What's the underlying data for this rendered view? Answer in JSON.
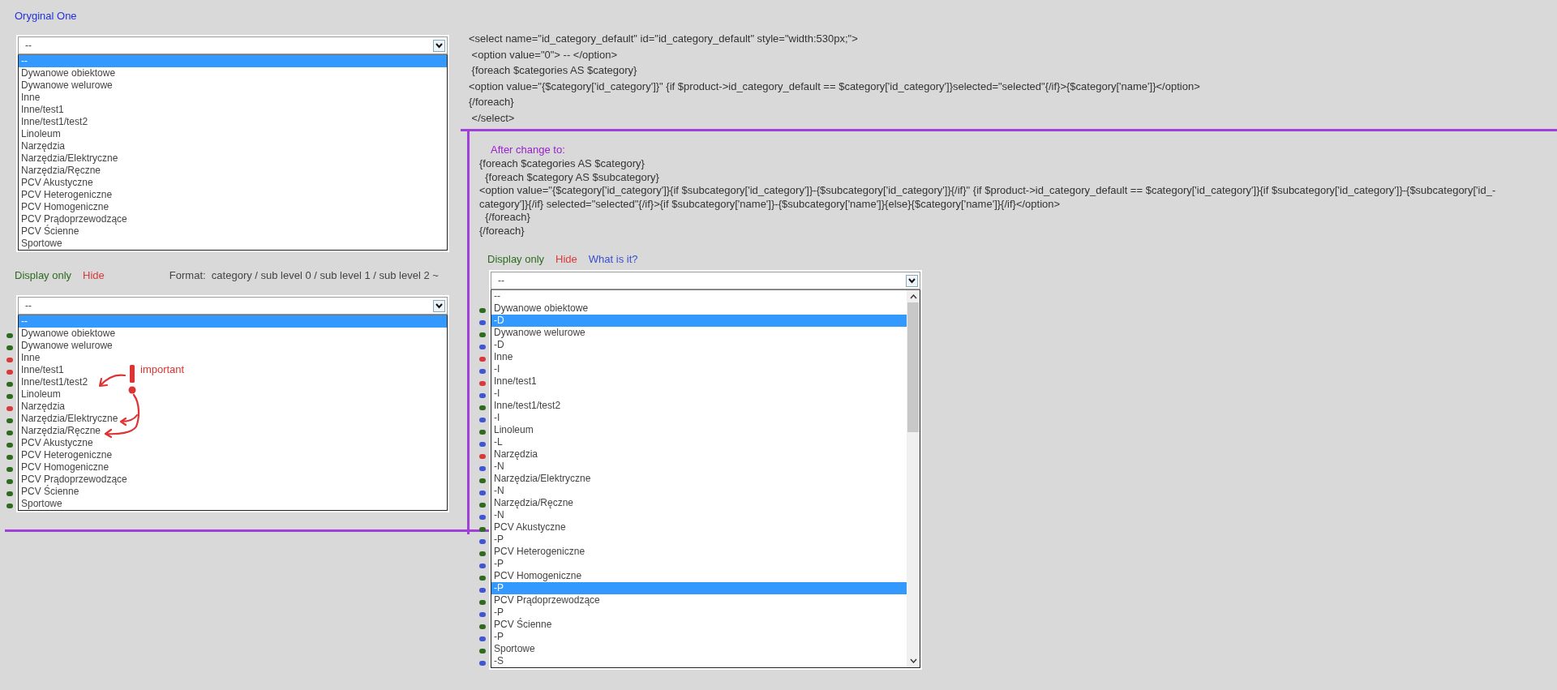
{
  "original": {
    "title": "Oryginal One",
    "dropdown": {
      "value": "--",
      "options": [
        {
          "label": "--",
          "selected": true
        },
        {
          "label": "Dywanowe obiektowe",
          "selected": false
        },
        {
          "label": "Dywanowe welurowe",
          "selected": false
        },
        {
          "label": "Inne",
          "selected": false
        },
        {
          "label": "Inne/test1",
          "selected": false
        },
        {
          "label": "Inne/test1/test2",
          "selected": false
        },
        {
          "label": "Linoleum",
          "selected": false
        },
        {
          "label": "Narzędzia",
          "selected": false
        },
        {
          "label": "Narzędzia/Elektryczne",
          "selected": false
        },
        {
          "label": "Narzędzia/Ręczne",
          "selected": false
        },
        {
          "label": "PCV Akustyczne",
          "selected": false
        },
        {
          "label": "PCV Heterogeniczne",
          "selected": false
        },
        {
          "label": "PCV Homogeniczne",
          "selected": false
        },
        {
          "label": "PCV Prądoprzewodzące",
          "selected": false
        },
        {
          "label": "PCV Ścienne",
          "selected": false
        },
        {
          "label": "Sportowe",
          "selected": false
        }
      ]
    }
  },
  "original_code": {
    "lines": [
      "<select name=\"id_category_default\" id=\"id_category_default\" style=\"width:530px;\">",
      " <option value=\"0\"> -- </option>",
      " {foreach $categories AS $category}",
      "<option value=\"{$category['id_category']}\" {if $product->id_category_default == $category['id_category']}selected=\"selected\"{/if}>{$category['name']}</option>",
      "{/foreach}",
      " </select>"
    ]
  },
  "display": {
    "links": [
      {
        "label": "Display only",
        "color": "#2e6b1e"
      },
      {
        "label": "Hide",
        "color": "#d9393a"
      }
    ],
    "format_note": "Format:  category / sub level 0 / sub level 1 / sub level 2 ~",
    "annotation": {
      "label": "important"
    },
    "dropdown": {
      "value": "--",
      "options": [
        {
          "label": "--",
          "selected": true
        },
        {
          "label": "Dywanowe obiektowe",
          "selected": false,
          "color": "#2e6b1e"
        },
        {
          "label": "Dywanowe welurowe",
          "selected": false,
          "color": "#2e6b1e"
        },
        {
          "label": "Inne",
          "selected": false,
          "color": "#d9393a"
        },
        {
          "label": "Inne/test1",
          "selected": false,
          "color": "#d9393a"
        },
        {
          "label": "Inne/test1/test2",
          "selected": false,
          "color": "#2e6b1e"
        },
        {
          "label": "Linoleum",
          "selected": false,
          "color": "#2e6b1e"
        },
        {
          "label": "Narzędzia",
          "selected": false,
          "color": "#d9393a"
        },
        {
          "label": "Narzędzia/Elektryczne",
          "selected": false,
          "color": "#2e6b1e"
        },
        {
          "label": "Narzędzia/Ręczne",
          "selected": false,
          "color": "#2e6b1e"
        },
        {
          "label": "PCV Akustyczne",
          "selected": false,
          "color": "#2e6b1e"
        },
        {
          "label": "PCV Heterogeniczne",
          "selected": false,
          "color": "#2e6b1e"
        },
        {
          "label": "PCV Homogeniczne",
          "selected": false,
          "color": "#2e6b1e"
        },
        {
          "label": "PCV Prądoprzewodzące",
          "selected": false,
          "color": "#2e6b1e"
        },
        {
          "label": "PCV Ścienne",
          "selected": false,
          "color": "#2e6b1e"
        },
        {
          "label": "Sportowe",
          "selected": false,
          "color": "#2e6b1e"
        }
      ]
    }
  },
  "after_change": {
    "title": "After change to:",
    "lines": [
      "{foreach $categories AS $category}",
      "  {foreach $category AS $subcategory}",
      "<option value=\"{$category['id_category']}{if $subcategory['id_category']}-{$subcategory['id_category']}{/if}\" {if $product->id_category_default == $category['id_category']}{if $subcategory['id_category']}-{$subcategory['id_-",
      "category']}{/if} selected=\"selected\"{/if}>{if $subcategory['name']}-{$subcategory['name']}{else}{$category['name']}{/if}</option>",
      "  {/foreach}",
      "{/foreach}"
    ],
    "links": [
      {
        "label": "Display only",
        "color": "#2e6b1e"
      },
      {
        "label": "Hide",
        "color": "#d9393a"
      },
      {
        "label": "What is it?",
        "color": "#3a4fd0"
      }
    ],
    "dropdown": {
      "value": "--",
      "scrollable": true,
      "options": [
        {
          "label": "--",
          "highlighted": false
        },
        {
          "label": "Dywanowe obiektowe",
          "highlighted": false,
          "color": "#2e6b1e"
        },
        {
          "label": "-D",
          "highlighted": true,
          "color": "#3d55d6"
        },
        {
          "label": "Dywanowe welurowe",
          "highlighted": false,
          "color": "#2e6b1e"
        },
        {
          "label": "-D",
          "highlighted": false,
          "color": "#3d55d6"
        },
        {
          "label": "Inne",
          "highlighted": false,
          "color": "#d9393a"
        },
        {
          "label": "-I",
          "highlighted": false,
          "color": "#3d55d6"
        },
        {
          "label": "Inne/test1",
          "highlighted": false,
          "color": "#d9393a"
        },
        {
          "label": "-I",
          "highlighted": false,
          "color": "#3d55d6"
        },
        {
          "label": "Inne/test1/test2",
          "highlighted": false,
          "color": "#2e6b1e"
        },
        {
          "label": "-I",
          "highlighted": false,
          "color": "#3d55d6"
        },
        {
          "label": "Linoleum",
          "highlighted": false,
          "color": "#2e6b1e"
        },
        {
          "label": "-L",
          "highlighted": false,
          "color": "#3d55d6"
        },
        {
          "label": "Narzędzia",
          "highlighted": false,
          "color": "#d9393a"
        },
        {
          "label": "-N",
          "highlighted": false,
          "color": "#3d55d6"
        },
        {
          "label": "Narzędzia/Elektryczne",
          "highlighted": false,
          "color": "#2e6b1e"
        },
        {
          "label": "-N",
          "highlighted": false,
          "color": "#3d55d6"
        },
        {
          "label": "Narzędzia/Ręczne",
          "highlighted": false,
          "color": "#2e6b1e"
        },
        {
          "label": "-N",
          "highlighted": false,
          "color": "#3d55d6"
        },
        {
          "label": "PCV Akustyczne",
          "highlighted": false,
          "color": "#2e6b1e"
        },
        {
          "label": "-P",
          "highlighted": false,
          "color": "#3d55d6"
        },
        {
          "label": "PCV Heterogeniczne",
          "highlighted": false,
          "color": "#2e6b1e"
        },
        {
          "label": "-P",
          "highlighted": false,
          "color": "#3d55d6"
        },
        {
          "label": "PCV Homogeniczne",
          "highlighted": false,
          "color": "#2e6b1e"
        },
        {
          "label": "-P",
          "highlighted": true,
          "color": "#3d55d6"
        },
        {
          "label": "PCV Prądoprzewodzące",
          "highlighted": false,
          "color": "#2e6b1e"
        },
        {
          "label": "-P",
          "highlighted": false,
          "color": "#3d55d6"
        },
        {
          "label": "PCV Ścienne",
          "highlighted": false,
          "color": "#2e6b1e"
        },
        {
          "label": "-P",
          "highlighted": false,
          "color": "#3d55d6"
        },
        {
          "label": "Sportowe",
          "highlighted": false,
          "color": "#2e6b1e"
        },
        {
          "label": "-S",
          "highlighted": false,
          "color": "#3d55d6"
        }
      ]
    }
  }
}
